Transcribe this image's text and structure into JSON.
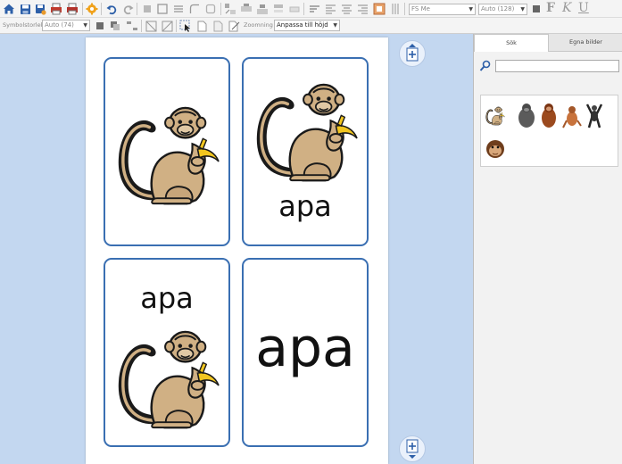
{
  "toolbar": {
    "font_value": "FS Me",
    "size_value": "Auto (128)",
    "bold_label": "F",
    "italic_label": "K",
    "underline_label": "U"
  },
  "toolbar2": {
    "symbol_size_label": "Symbolstorlek",
    "symbol_size_value": "Auto (74)",
    "zoom_label": "Zoomning",
    "zoom_value": "Anpassa till höjd"
  },
  "cards": [
    {
      "word": "",
      "show_word": false
    },
    {
      "word": "apa",
      "show_word": true
    },
    {
      "word": "apa",
      "show_word": true
    },
    {
      "word": "apa",
      "show_word": true
    }
  ],
  "panel": {
    "tabs": [
      {
        "label": "Sök",
        "active": true
      },
      {
        "label": "Egna bilder",
        "active": false
      }
    ],
    "search_value": "",
    "results": [
      "monkey-banana",
      "gorilla",
      "orangutan",
      "small-monkey",
      "gibbon",
      "chimp-face"
    ]
  },
  "colors": {
    "card_border": "#3a6fb2",
    "workspace": "#c3d7f0",
    "monkey_body": "#d0b084",
    "monkey_outline": "#1a1a1a",
    "banana": "#f2c61f"
  }
}
